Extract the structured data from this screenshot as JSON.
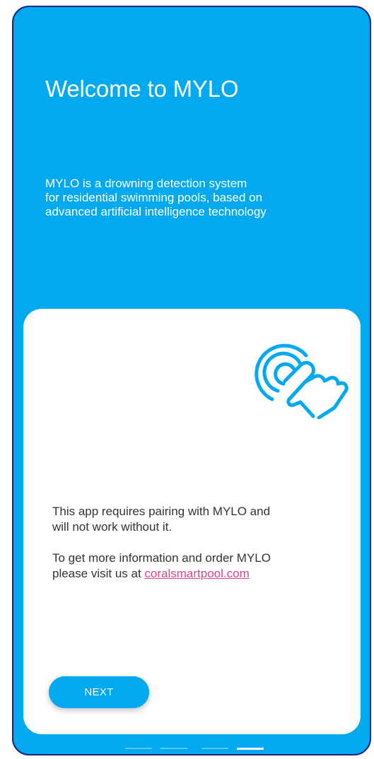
{
  "welcome": {
    "title": "Welcome to MYLO",
    "intro_lines": [
      "MYLO is a drowning detection system",
      "for residential swimming pools, based on",
      "advanced artificial intelligence technology"
    ]
  },
  "card": {
    "icon": "touch-hand-icon",
    "message_lines": [
      "This app requires pairing with MYLO and",
      "will not work without it."
    ],
    "info_line1": "To get more information and order MYLO",
    "info_line2_prefix": "please visit us at ",
    "link_text": "coralsmartpool.com",
    "next_label": "NEXT"
  },
  "pager": {
    "total": 4,
    "active": 4
  },
  "colors": {
    "primary": "#03a9ee",
    "link": "#e0458a",
    "text": "#333333"
  }
}
